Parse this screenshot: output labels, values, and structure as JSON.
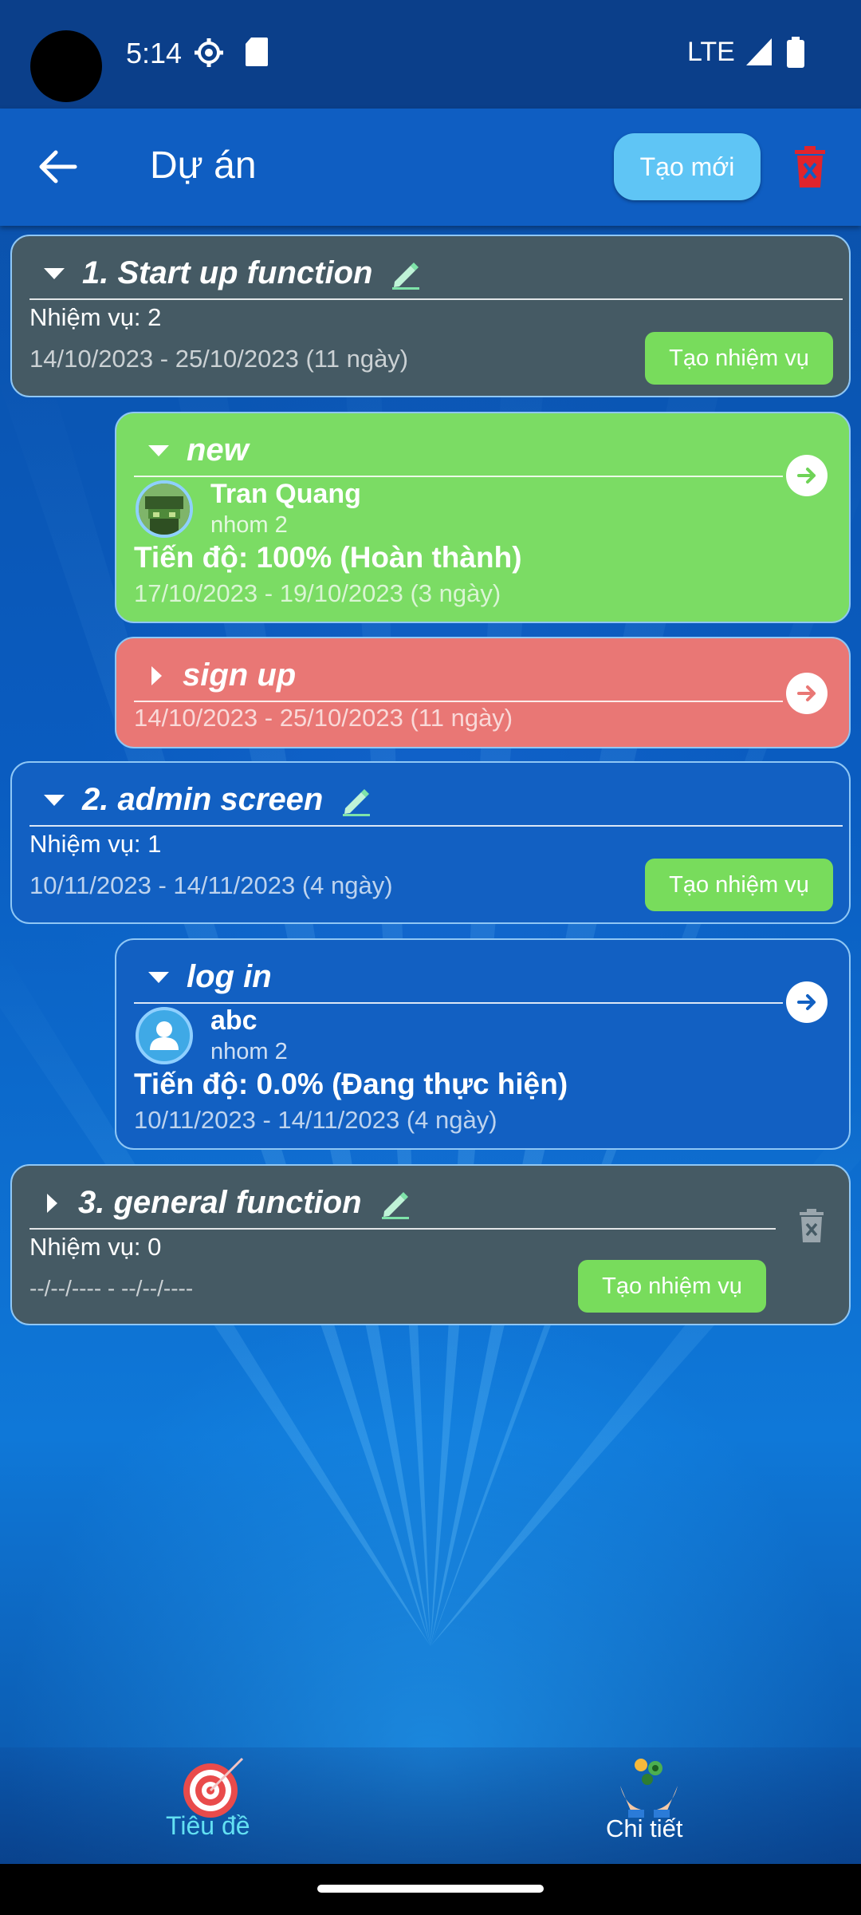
{
  "status_bar": {
    "time": "5:14",
    "network": "LTE"
  },
  "app_bar": {
    "title": "Dự án",
    "new_button": "Tạo mới"
  },
  "projects": [
    {
      "title": "1. Start up function",
      "task_count": "Nhiệm vụ: 2",
      "dates": "14/10/2023 - 25/10/2023 (11 ngày)",
      "create_task": "Tạo nhiệm vụ",
      "tasks": [
        {
          "title": "new",
          "assignee": "Tran Quang",
          "group": "nhom 2",
          "progress": "Tiến độ: 100% (Hoàn thành)",
          "dates": "17/10/2023 - 19/10/2023 (3 ngày)",
          "status_color": "#7bdc64"
        },
        {
          "title": "sign up",
          "dates": "14/10/2023 - 25/10/2023 (11 ngày)",
          "status_color": "#e97775"
        }
      ]
    },
    {
      "title": "2. admin screen",
      "task_count": "Nhiệm vụ: 1",
      "dates": "10/11/2023 - 14/11/2023 (4 ngày)",
      "create_task": "Tạo nhiệm vụ",
      "tasks": [
        {
          "title": "log in",
          "assignee": "abc",
          "group": "nhom 2",
          "progress": "Tiến độ: 0.0% (Đang thực hiện)",
          "dates": "10/11/2023 - 14/11/2023 (4 ngày)",
          "status_color": "#1260c2"
        }
      ]
    },
    {
      "title": "3. general function",
      "task_count": "Nhiệm vụ: 0",
      "dates": "--/--/---- - --/--/----",
      "create_task": "Tạo nhiệm vụ",
      "tasks": []
    }
  ],
  "bottom_nav": {
    "items": [
      {
        "label": "Tiêu đề",
        "icon": "target-icon",
        "active": true
      },
      {
        "label": "Chi tiết",
        "icon": "hands-gear-icon",
        "active": false
      }
    ]
  },
  "colors": {
    "accent": "#5fc5f5",
    "active_nav": "#63e0f2",
    "delete": "#e0242c"
  }
}
